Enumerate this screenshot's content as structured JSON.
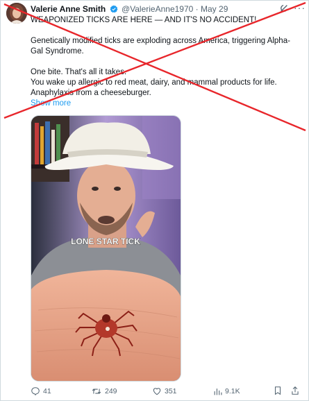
{
  "post": {
    "display_name": "Valerie Anne Smith",
    "handle": "@ValerieAnne1970",
    "separator": "·",
    "date": "May 29",
    "lines": [
      "WEAPONIZED TICKS ARE HERE — AND IT'S NO ACCIDENT!",
      "Genetically modified ticks are exploding across America, triggering Alpha-Gal Syndrome.",
      "One bite. That's all it takes.",
      "You wake up allergic to red meat, dairy, and mammal products for life.",
      "Anaphylaxis from a cheeseburger."
    ],
    "show_more": "Show more"
  },
  "media": {
    "caption": "LONE STAR TICK"
  },
  "actions": {
    "replies": "41",
    "reposts": "249",
    "likes": "351",
    "views": "9.1K"
  },
  "colors": {
    "overlay_x": "#e8262b",
    "link": "#1d9bf0",
    "muted": "#536471",
    "verified": "#1d9bf0"
  },
  "icons": [
    "verified-badge-icon",
    "grok-icon",
    "more-icon",
    "reply-icon",
    "repost-icon",
    "like-icon",
    "views-icon",
    "bookmark-icon",
    "share-icon"
  ]
}
